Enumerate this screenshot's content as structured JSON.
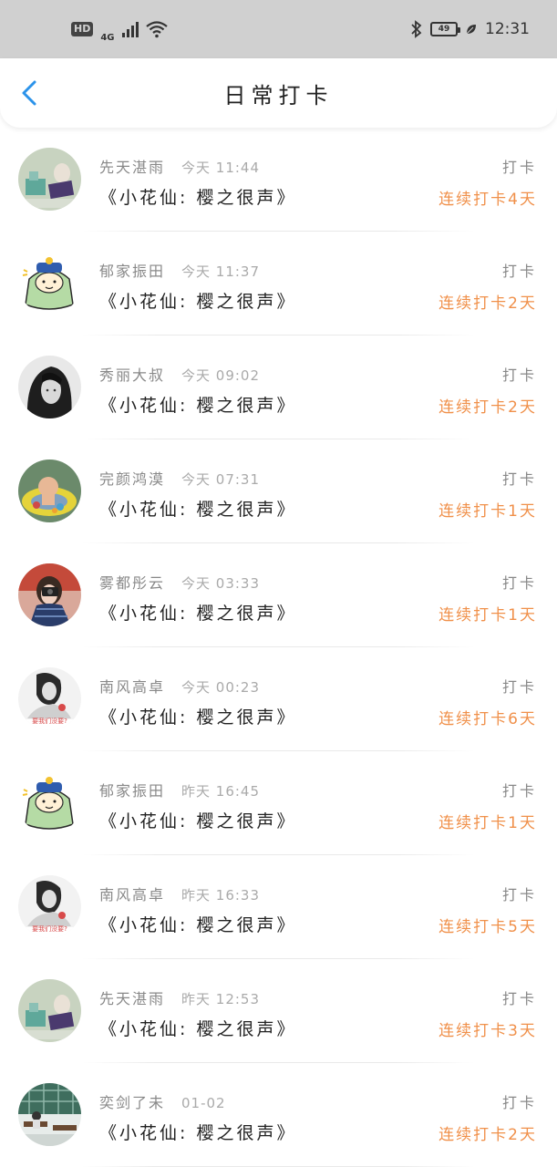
{
  "status_bar": {
    "hd": "HD",
    "network": "4G",
    "battery": "49",
    "time": "12:31"
  },
  "header": {
    "title": "日常打卡"
  },
  "colors": {
    "accent_blue": "#2c93ea",
    "streak_orange": "#f0904a",
    "status_bar_bg": "#d0d0d0"
  },
  "items": [
    {
      "user": "先天湛雨",
      "time": "今天 11:44",
      "book": "《小花仙: 樱之很声》",
      "type": "打卡",
      "streak": "连续打卡4天",
      "avatar": "avatar-laptop"
    },
    {
      "user": "郁家振田",
      "time": "今天 11:37",
      "book": "《小花仙: 樱之很声》",
      "type": "打卡",
      "streak": "连续打卡2天",
      "avatar": "avatar-cartoon"
    },
    {
      "user": "秀丽大叔",
      "time": "今天 09:02",
      "book": "《小花仙: 樱之很声》",
      "type": "打卡",
      "streak": "连续打卡2天",
      "avatar": "avatar-girl-bw"
    },
    {
      "user": "完颜鸿漠",
      "time": "今天 07:31",
      "book": "《小花仙: 樱之很声》",
      "type": "打卡",
      "streak": "连续打卡1天",
      "avatar": "avatar-baby"
    },
    {
      "user": "雾都彤云",
      "time": "今天 03:33",
      "book": "《小花仙: 樱之很声》",
      "type": "打卡",
      "streak": "连续打卡1天",
      "avatar": "avatar-camera"
    },
    {
      "user": "南风高卓",
      "time": "今天 00:23",
      "book": "《小花仙: 樱之很声》",
      "type": "打卡",
      "streak": "连续打卡6天",
      "avatar": "avatar-text"
    },
    {
      "user": "郁家振田",
      "time": "昨天 16:45",
      "book": "《小花仙: 樱之很声》",
      "type": "打卡",
      "streak": "连续打卡1天",
      "avatar": "avatar-cartoon"
    },
    {
      "user": "南风高卓",
      "time": "昨天 16:33",
      "book": "《小花仙: 樱之很声》",
      "type": "打卡",
      "streak": "连续打卡5天",
      "avatar": "avatar-text"
    },
    {
      "user": "先天湛雨",
      "time": "昨天 12:53",
      "book": "《小花仙: 樱之很声》",
      "type": "打卡",
      "streak": "连续打卡3天",
      "avatar": "avatar-laptop"
    },
    {
      "user": "奕剑了未",
      "time": "01-02",
      "book": "《小花仙: 樱之很声》",
      "type": "打卡",
      "streak": "连续打卡2天",
      "avatar": "avatar-classroom"
    }
  ],
  "avatar_caption": "要我们没要?"
}
